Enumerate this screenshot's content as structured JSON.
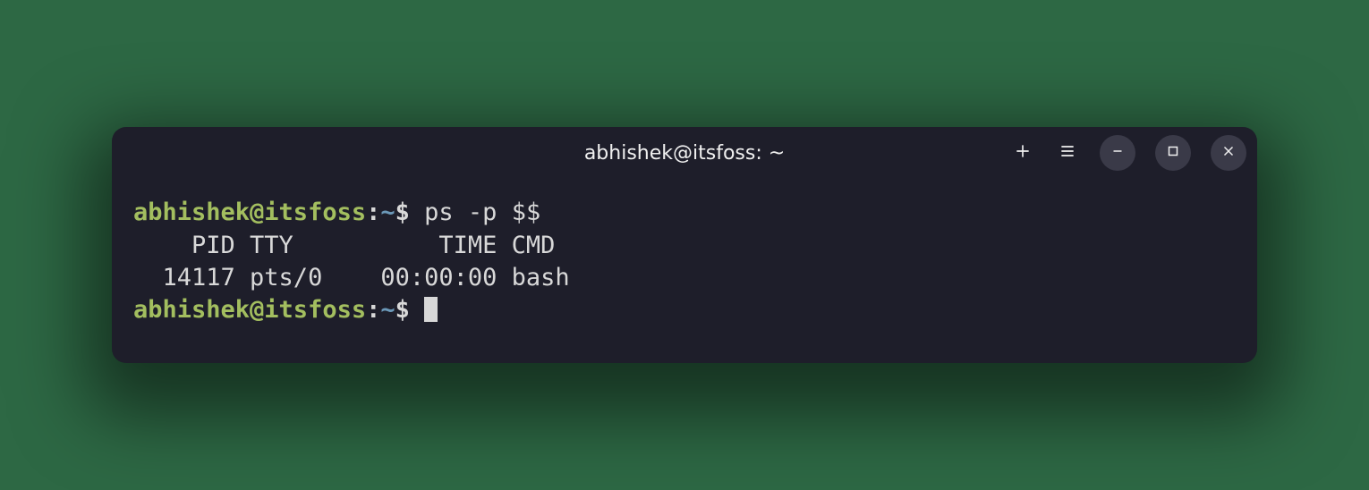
{
  "window": {
    "title": "abhishek@itsfoss: ~"
  },
  "prompt": {
    "user_host": "abhishek@itsfoss",
    "separator": ":",
    "path": "~",
    "symbol": "$"
  },
  "session": {
    "command1": "ps -p $$",
    "output_header": "    PID TTY          TIME CMD",
    "output_row": "  14117 pts/0    00:00:00 bash"
  }
}
